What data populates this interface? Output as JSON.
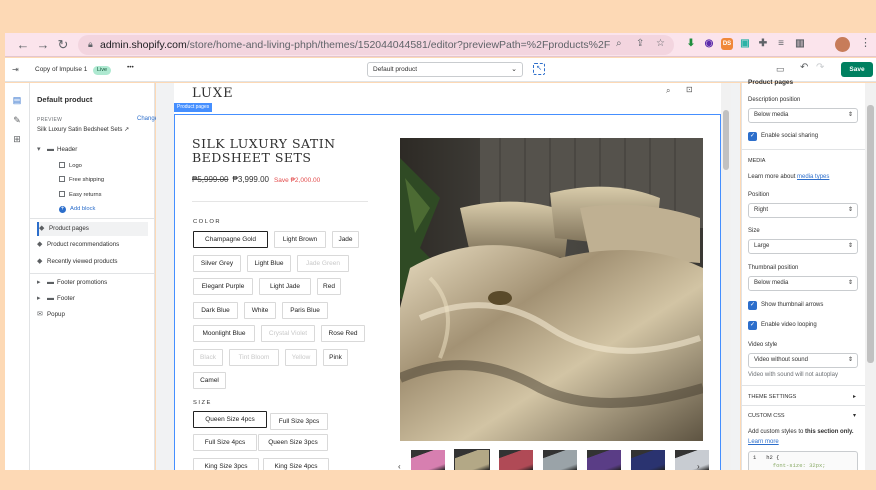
{
  "browser": {
    "url_host": "admin.shopify.com",
    "url_path": "/store/home-and-living-phph/themes/152044044581/editor?previewPath=%2Fproducts%2Fsilk-lu...",
    "extensions": [
      {
        "name": "download-arrow-icon",
        "label": "",
        "color": "#1e8e3e"
      },
      {
        "name": "download-circle-icon",
        "label": "",
        "color": "#5b2bab"
      },
      {
        "name": "ds-extension-icon",
        "label": "DS",
        "color": "#f0883a"
      },
      {
        "name": "screen-extension-icon",
        "label": "",
        "color": "#2bb3a6"
      },
      {
        "name": "puzzle-icon",
        "label": "",
        "color": "#5f6368"
      },
      {
        "name": "playlist-icon",
        "label": "",
        "color": "#5f6368"
      },
      {
        "name": "sidepanel-icon",
        "label": "",
        "color": "#5f6368"
      }
    ]
  },
  "topbar": {
    "theme_name": "Copy of Impulse 1",
    "live_badge": "Live",
    "more": "•••",
    "template_select": "Default product",
    "save_label": "Save"
  },
  "left_panel": {
    "title": "Default product",
    "preview_label": "PREVIEW",
    "change_label": "Change",
    "preview_product": "Silk Luxury Satin Bedsheet Sets",
    "header_label": "Header",
    "header_children": [
      "Logo",
      "Free shipping",
      "Easy returns"
    ],
    "add_block": "Add block",
    "sections": [
      "Product pages",
      "Product recommendations",
      "Recently viewed products"
    ],
    "footer_sections": [
      "Footer promotions",
      "Footer",
      "Popup"
    ]
  },
  "preview": {
    "section_tag": "Product pages",
    "logo": "LUXE",
    "title": "SILK LUXURY SATIN BEDSHEET SETS",
    "old_price": "₱5,999.00",
    "price": "₱3,999.00",
    "save_text": "Save ₱2,000.00",
    "color_label": "COLOR",
    "colors": [
      {
        "label": "Champagne Gold",
        "selected": true,
        "available": true
      },
      {
        "label": "Light Brown",
        "selected": false,
        "available": true
      },
      {
        "label": "Jade",
        "selected": false,
        "available": true
      },
      {
        "label": "Silver Grey",
        "selected": false,
        "available": true
      },
      {
        "label": "Light Blue",
        "selected": false,
        "available": true
      },
      {
        "label": "Jade Green",
        "selected": false,
        "available": false
      },
      {
        "label": "Elegant Purple",
        "selected": false,
        "available": true
      },
      {
        "label": "Light Jade",
        "selected": false,
        "available": true
      },
      {
        "label": "Red",
        "selected": false,
        "available": true
      },
      {
        "label": "Dark Blue",
        "selected": false,
        "available": true
      },
      {
        "label": "White",
        "selected": false,
        "available": true
      },
      {
        "label": "Paris Blue",
        "selected": false,
        "available": true
      },
      {
        "label": "Moonlight Blue",
        "selected": false,
        "available": true
      },
      {
        "label": "Crystal Violet",
        "selected": false,
        "available": false
      },
      {
        "label": "Rose Red",
        "selected": false,
        "available": true
      },
      {
        "label": "Black",
        "selected": false,
        "available": false
      },
      {
        "label": "Tint Bloom",
        "selected": false,
        "available": false
      },
      {
        "label": "Yellow",
        "selected": false,
        "available": false
      },
      {
        "label": "Pink",
        "selected": false,
        "available": true
      },
      {
        "label": "Camel",
        "selected": false,
        "available": true
      }
    ],
    "size_label": "SIZE",
    "sizes": [
      {
        "label": "Queen Size 4pcs",
        "selected": true
      },
      {
        "label": "Full Size 3pcs",
        "selected": false
      },
      {
        "label": "Full Size 4pcs",
        "selected": false
      },
      {
        "label": "Queen Size 3pcs",
        "selected": false
      },
      {
        "label": "King Size 3pcs",
        "selected": false
      },
      {
        "label": "King Size 4pcs",
        "selected": false
      }
    ],
    "thumb_colors": [
      "#d77fb0",
      "#b3a886",
      "#b04a56",
      "#9aa3a8",
      "#5a3d86",
      "#2a3370",
      "#c8ccd2"
    ]
  },
  "right_panel": {
    "heading": "Product pages",
    "description_position_label": "Description position",
    "description_position": "Below media",
    "enable_social_sharing": "Enable social sharing",
    "media_heading": "MEDIA",
    "learn_more_prefix": "Learn more about ",
    "learn_more_link": "media types",
    "position_label": "Position",
    "position": "Right",
    "size_label": "Size",
    "size": "Large",
    "thumbnail_position_label": "Thumbnail position",
    "thumbnail_position": "Below media",
    "show_thumbnail_arrows": "Show thumbnail arrows",
    "enable_video_looping": "Enable video looping",
    "video_style_label": "Video style",
    "video_style": "Video without sound",
    "video_note": "Video with sound will not autoplay",
    "theme_settings": "THEME SETTINGS",
    "custom_css": "CUSTOM CSS",
    "custom_css_desc_prefix": "Add custom styles to ",
    "custom_css_desc_bold": "this section only.",
    "learn_more": "Learn more",
    "code_line1": "1   h2 {",
    "code_line2": "      font-size: 32px;"
  }
}
